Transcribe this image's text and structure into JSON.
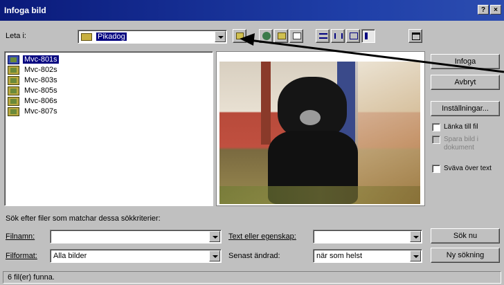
{
  "titlebar": {
    "title": "Infoga bild",
    "help": "?",
    "close": "×"
  },
  "lookin": {
    "label": "Leta i:",
    "value": "Pikadog"
  },
  "files": [
    {
      "name": "Mvc-801s",
      "selected": true
    },
    {
      "name": "Mvc-802s",
      "selected": false
    },
    {
      "name": "Mvc-803s",
      "selected": false
    },
    {
      "name": "Mvc-805s",
      "selected": false
    },
    {
      "name": "Mvc-806s",
      "selected": false
    },
    {
      "name": "Mvc-807s",
      "selected": false
    }
  ],
  "buttons": {
    "insert": "Infoga",
    "cancel": "Avbryt",
    "settings": "Inställningar...",
    "find_now": "Sök nu",
    "new_search": "Ny sökning"
  },
  "checks": {
    "link": "Länka till fil",
    "save_with": "Spara bild i dokument",
    "float": "Sväva över text"
  },
  "search": {
    "criteria": "Sök efter filer som matchar dessa sökkriterier:",
    "filename_label": "Filnamn:",
    "filename_value": "",
    "filetype_label": "Filformat:",
    "filetype_value": "Alla bilder",
    "text_label": "Text eller egenskap:",
    "text_value": "",
    "modified_label": "Senast ändrad:",
    "modified_value": "när som helst"
  },
  "status": "6 fil(er) funna.",
  "colors": {
    "title_bar": "#0a1a7a",
    "selection": "#000080",
    "face": "#c0c0c0"
  }
}
